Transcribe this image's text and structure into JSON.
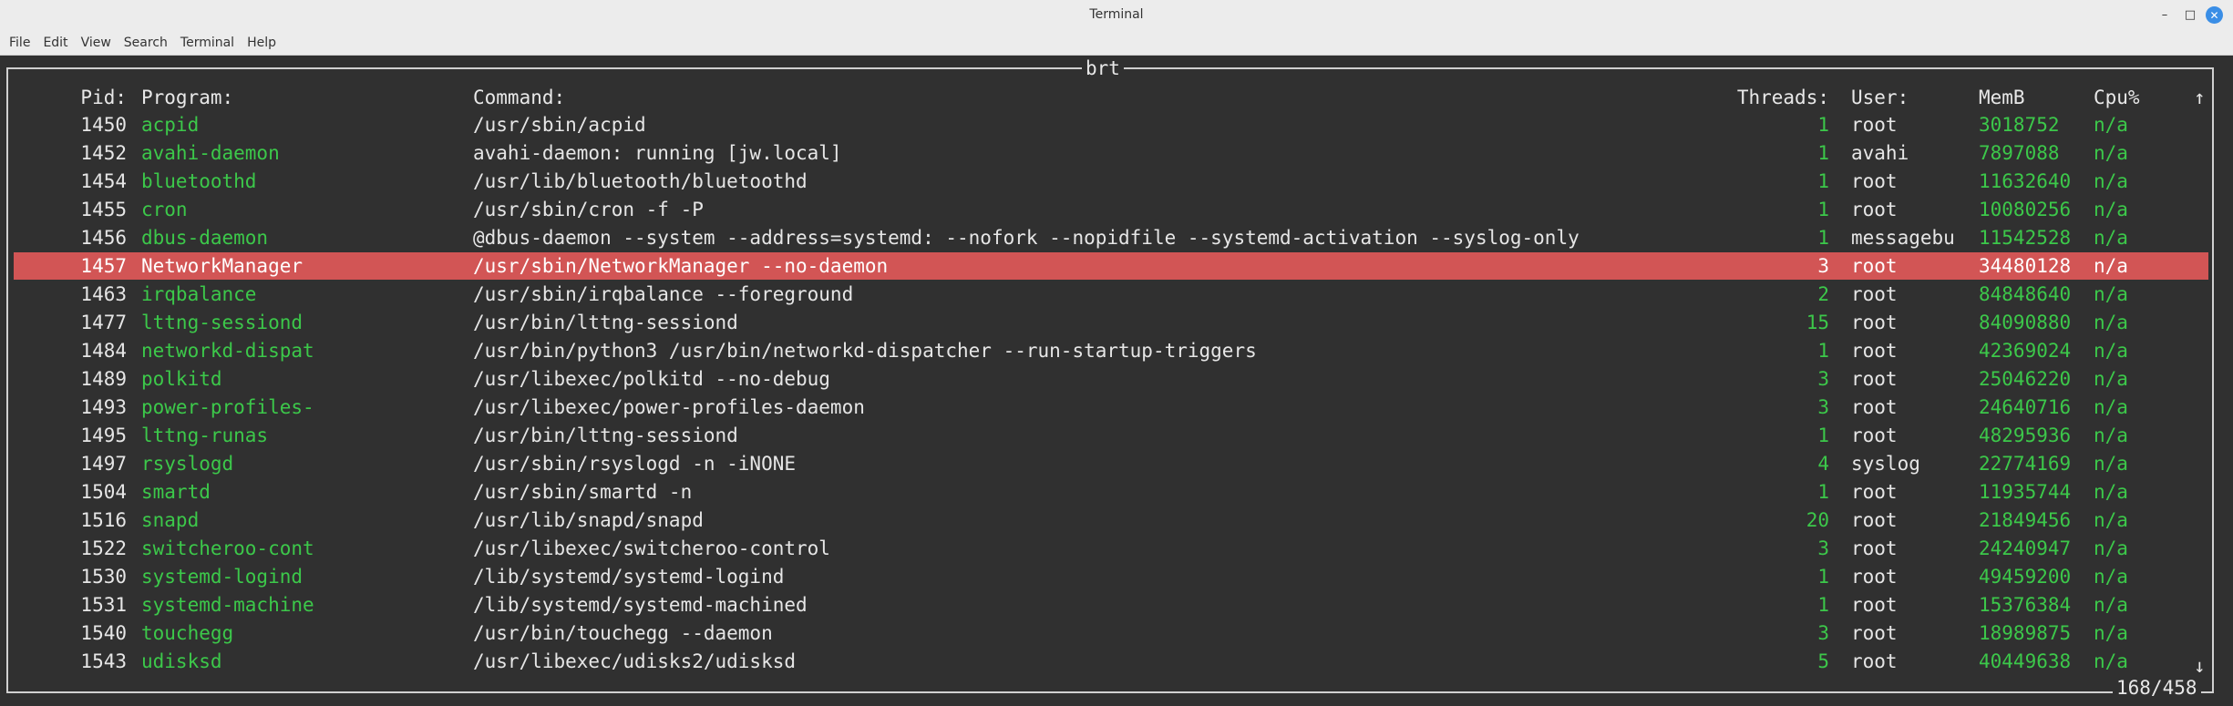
{
  "window": {
    "title": "Terminal"
  },
  "menu": [
    "File",
    "Edit",
    "View",
    "Search",
    "Terminal",
    "Help"
  ],
  "app": {
    "frame_title": "brt",
    "position": "168/458"
  },
  "headers": {
    "pid": "Pid:",
    "program": "Program:",
    "command": "Command:",
    "threads": "Threads:",
    "user": "User:",
    "memb": "MemB",
    "cpu": "Cpu%",
    "sort_arrow": "↑",
    "scroll_down": "↓"
  },
  "rows": [
    {
      "pid": "1450",
      "program": "acpid",
      "command": "/usr/sbin/acpid",
      "threads": "1",
      "user": "root",
      "memb": "3018752",
      "cpu": "n/a"
    },
    {
      "pid": "1452",
      "program": "avahi-daemon",
      "command": "avahi-daemon: running [jw.local]",
      "threads": "1",
      "user": "avahi",
      "memb": "7897088",
      "cpu": "n/a"
    },
    {
      "pid": "1454",
      "program": "bluetoothd",
      "command": "/usr/lib/bluetooth/bluetoothd",
      "threads": "1",
      "user": "root",
      "memb": "11632640",
      "cpu": "n/a"
    },
    {
      "pid": "1455",
      "program": "cron",
      "command": "/usr/sbin/cron -f -P",
      "threads": "1",
      "user": "root",
      "memb": "10080256",
      "cpu": "n/a"
    },
    {
      "pid": "1456",
      "program": "dbus-daemon",
      "command": "@dbus-daemon --system --address=systemd: --nofork --nopidfile --systemd-activation --syslog-only",
      "threads": "1",
      "user": "messagebu",
      "memb": "11542528",
      "cpu": "n/a"
    },
    {
      "pid": "1457",
      "program": "NetworkManager",
      "command": "/usr/sbin/NetworkManager --no-daemon",
      "threads": "3",
      "user": "root",
      "memb": "34480128",
      "cpu": "n/a",
      "selected": true
    },
    {
      "pid": "1463",
      "program": "irqbalance",
      "command": "/usr/sbin/irqbalance --foreground",
      "threads": "2",
      "user": "root",
      "memb": "84848640",
      "cpu": "n/a"
    },
    {
      "pid": "1477",
      "program": "lttng-sessiond",
      "command": "/usr/bin/lttng-sessiond",
      "threads": "15",
      "user": "root",
      "memb": "84090880",
      "cpu": "n/a"
    },
    {
      "pid": "1484",
      "program": "networkd-dispat",
      "command": "/usr/bin/python3 /usr/bin/networkd-dispatcher --run-startup-triggers",
      "threads": "1",
      "user": "root",
      "memb": "42369024",
      "cpu": "n/a"
    },
    {
      "pid": "1489",
      "program": "polkitd",
      "command": "/usr/libexec/polkitd --no-debug",
      "threads": "3",
      "user": "root",
      "memb": "25046220",
      "cpu": "n/a"
    },
    {
      "pid": "1493",
      "program": "power-profiles-",
      "command": "/usr/libexec/power-profiles-daemon",
      "threads": "3",
      "user": "root",
      "memb": "24640716",
      "cpu": "n/a"
    },
    {
      "pid": "1495",
      "program": "lttng-runas",
      "command": "/usr/bin/lttng-sessiond",
      "threads": "1",
      "user": "root",
      "memb": "48295936",
      "cpu": "n/a"
    },
    {
      "pid": "1497",
      "program": "rsyslogd",
      "command": "/usr/sbin/rsyslogd -n -iNONE",
      "threads": "4",
      "user": "syslog",
      "memb": "22774169",
      "cpu": "n/a"
    },
    {
      "pid": "1504",
      "program": "smartd",
      "command": "/usr/sbin/smartd -n",
      "threads": "1",
      "user": "root",
      "memb": "11935744",
      "cpu": "n/a"
    },
    {
      "pid": "1516",
      "program": "snapd",
      "command": "/usr/lib/snapd/snapd",
      "threads": "20",
      "user": "root",
      "memb": "21849456",
      "cpu": "n/a"
    },
    {
      "pid": "1522",
      "program": "switcheroo-cont",
      "command": "/usr/libexec/switcheroo-control",
      "threads": "3",
      "user": "root",
      "memb": "24240947",
      "cpu": "n/a"
    },
    {
      "pid": "1530",
      "program": "systemd-logind",
      "command": "/lib/systemd/systemd-logind",
      "threads": "1",
      "user": "root",
      "memb": "49459200",
      "cpu": "n/a"
    },
    {
      "pid": "1531",
      "program": "systemd-machine",
      "command": "/lib/systemd/systemd-machined",
      "threads": "1",
      "user": "root",
      "memb": "15376384",
      "cpu": "n/a"
    },
    {
      "pid": "1540",
      "program": "touchegg",
      "command": "/usr/bin/touchegg --daemon",
      "threads": "3",
      "user": "root",
      "memb": "18989875",
      "cpu": "n/a"
    },
    {
      "pid": "1543",
      "program": "udisksd",
      "command": "/usr/libexec/udisks2/udisksd",
      "threads": "5",
      "user": "root",
      "memb": "40449638",
      "cpu": "n/a"
    }
  ],
  "colors": {
    "selected_bg": "#d25555",
    "accent_green": "#3cc84a",
    "close_button": "#3a8ee6"
  }
}
